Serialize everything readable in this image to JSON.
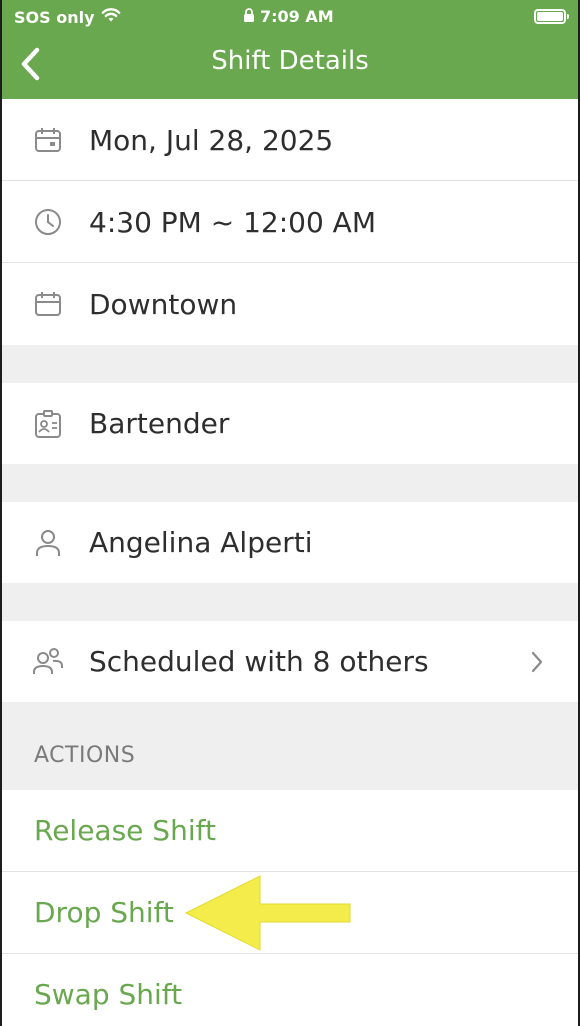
{
  "status_bar": {
    "carrier": "SOS only",
    "time": "7:09 AM"
  },
  "nav": {
    "title": "Shift Details"
  },
  "details": {
    "date": "Mon, Jul 28, 2025",
    "time_range": "4:30 PM ~ 12:00 AM",
    "location": "Downtown",
    "position": "Bartender",
    "employee": "Angelina Alperti",
    "coworkers": "Scheduled with 8 others"
  },
  "actions": {
    "header": "ACTIONS",
    "release": "Release Shift",
    "drop": "Drop Shift",
    "swap": "Swap Shift"
  },
  "colors": {
    "brand_green": "#6aa84f",
    "highlight_arrow": "#f4ec4a"
  },
  "icons": [
    "wifi-icon",
    "lock-icon",
    "battery-icon",
    "back-chevron-icon",
    "calendar-icon",
    "clock-icon",
    "location-calendar-icon",
    "id-badge-icon",
    "person-icon",
    "people-icon",
    "chevron-right-icon"
  ]
}
